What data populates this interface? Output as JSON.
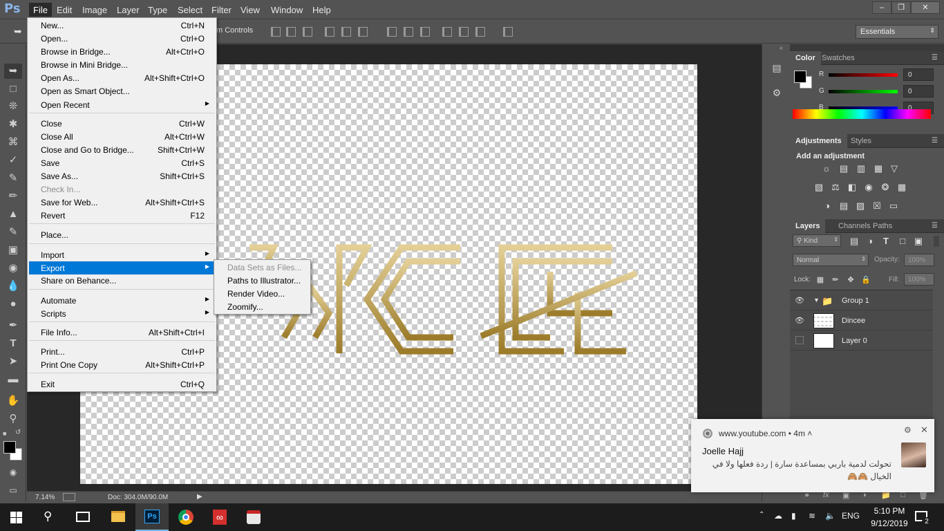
{
  "app": {
    "logo": "Ps"
  },
  "menubar": {
    "items": [
      "File",
      "Edit",
      "Image",
      "Layer",
      "Type",
      "Select",
      "Filter",
      "View",
      "Window",
      "Help"
    ]
  },
  "options": {
    "label": "m Controls",
    "workspace": "Essentials"
  },
  "file_menu": {
    "items": [
      {
        "label": "New...",
        "shortcut": "Ctrl+N"
      },
      {
        "label": "Open...",
        "shortcut": "Ctrl+O"
      },
      {
        "label": "Browse in Bridge...",
        "shortcut": "Alt+Ctrl+O"
      },
      {
        "label": "Browse in Mini Bridge...",
        "shortcut": ""
      },
      {
        "label": "Open As...",
        "shortcut": "Alt+Shift+Ctrl+O"
      },
      {
        "label": "Open as Smart Object...",
        "shortcut": ""
      },
      {
        "label": "Open Recent",
        "shortcut": ""
      },
      {
        "label": "Close",
        "shortcut": "Ctrl+W"
      },
      {
        "label": "Close All",
        "shortcut": "Alt+Ctrl+W"
      },
      {
        "label": "Close and Go to Bridge...",
        "shortcut": "Shift+Ctrl+W"
      },
      {
        "label": "Save",
        "shortcut": "Ctrl+S"
      },
      {
        "label": "Save As...",
        "shortcut": "Shift+Ctrl+S"
      },
      {
        "label": "Check In...",
        "shortcut": ""
      },
      {
        "label": "Save for Web...",
        "shortcut": "Alt+Shift+Ctrl+S"
      },
      {
        "label": "Revert",
        "shortcut": "F12"
      },
      {
        "label": "Place...",
        "shortcut": ""
      },
      {
        "label": "Import",
        "shortcut": ""
      },
      {
        "label": "Export",
        "shortcut": ""
      },
      {
        "label": "Share on Behance...",
        "shortcut": ""
      },
      {
        "label": "Automate",
        "shortcut": ""
      },
      {
        "label": "Scripts",
        "shortcut": ""
      },
      {
        "label": "File Info...",
        "shortcut": "Alt+Shift+Ctrl+I"
      },
      {
        "label": "Print...",
        "shortcut": "Ctrl+P"
      },
      {
        "label": "Print One Copy",
        "shortcut": "Alt+Shift+Ctrl+P"
      },
      {
        "label": "Exit",
        "shortcut": "Ctrl+Q"
      }
    ]
  },
  "export_submenu": {
    "items": [
      "Data Sets as Files...",
      "Paths to Illustrator...",
      "Render Video...",
      "Zoomify..."
    ]
  },
  "status": {
    "zoom": "7.14%",
    "doc": "Doc: 304.0M/90.0M"
  },
  "color_panel": {
    "tabs": [
      "Color",
      "Swatches"
    ],
    "r_label": "R",
    "g_label": "G",
    "b_label": "B",
    "r": "0",
    "g": "0",
    "b": "0"
  },
  "adjustments_panel": {
    "tabs": [
      "Adjustments",
      "Styles"
    ],
    "title": "Add an adjustment"
  },
  "layers_panel": {
    "tabs": [
      "Layers",
      "Channels",
      "Paths"
    ],
    "filter": "Kind",
    "blend_mode": "Normal",
    "opacity_label": "Opacity:",
    "opacity": "100%",
    "lock_label": "Lock:",
    "fill_label": "Fill:",
    "fill": "100%",
    "layers": [
      {
        "name": "Group 1"
      },
      {
        "name": "Dincee"
      },
      {
        "name": "Layer 0"
      }
    ]
  },
  "notification": {
    "source": "www.youtube.com",
    "time": "4m",
    "author": "Joelle Hajj",
    "message": "تحولت لدمية باربي بمساعدة سارة | ردة فعلها ولا في الخيال 🙈🙈"
  },
  "taskbar": {
    "time": "5:10 PM",
    "date": "9/12/2019",
    "lang": "ENG",
    "notif_count": "2"
  },
  "colors": {
    "ps_bg": "#535353",
    "doc_bg": "#282828",
    "highlight": "#0078d7",
    "gold": "#c8a85a"
  }
}
